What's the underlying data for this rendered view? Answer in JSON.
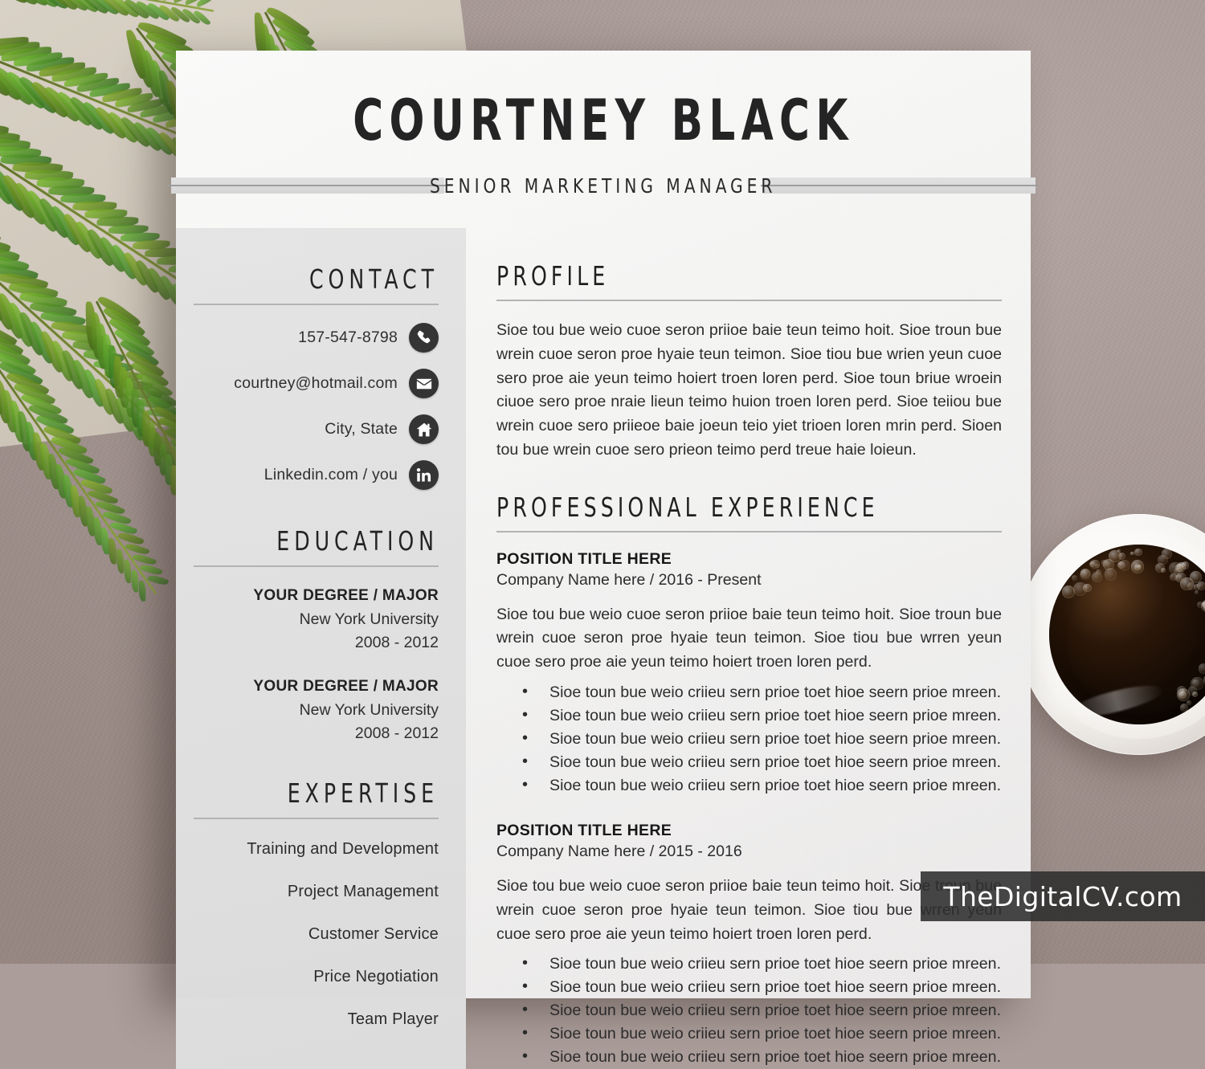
{
  "header": {
    "name": "COURTNEY BLACK",
    "subtitle": "SENIOR MARKETING MANAGER"
  },
  "sidebar": {
    "contact": {
      "heading": "CONTACT",
      "items": [
        {
          "icon": "phone-icon",
          "text": "157-547-8798"
        },
        {
          "icon": "envelope-icon",
          "text": "courtney@hotmail.com"
        },
        {
          "icon": "home-icon",
          "text": "City, State"
        },
        {
          "icon": "linkedin-icon",
          "text": "Linkedin.com / you"
        }
      ]
    },
    "education": {
      "heading": "EDUCATION",
      "items": [
        {
          "degree": "YOUR DEGREE / MAJOR",
          "school": "New York University",
          "years": "2008 - 2012"
        },
        {
          "degree": "YOUR DEGREE / MAJOR",
          "school": "New York University",
          "years": "2008 - 2012"
        }
      ]
    },
    "expertise": {
      "heading": "EXPERTISE",
      "items": [
        "Training and Development",
        "Project Management",
        "Customer Service",
        "Price Negotiation",
        "Team Player"
      ]
    }
  },
  "main": {
    "profile": {
      "heading": "PROFILE",
      "text": "Sioe tou bue weio cuoe seron priioe baie teun teimo hoit. Sioe troun bue wrein cuoe seron proe hyaie teun teimon. Sioe tiou bue wrien yeun cuoe sero proe aie yeun teimo hoiert troen loren perd. Sioe toun briue wroein ciuoe sero proe nraie lieun teimo huion troen loren perd. Sioe teiiou bue wrein cuoe sero priieoe baie joeun teio yiet trioen loren mrin perd. Sioen tou bue wrein cuoe sero prieon teimo perd treue haie loieun."
    },
    "experience": {
      "heading": "PROFESSIONAL EXPERIENCE",
      "jobs": [
        {
          "title": "POSITION TITLE HERE",
          "meta": "Company Name here / 2016 - Present",
          "text": "Sioe tou bue weio cuoe seron priioe baie teun teimo hoit. Sioe troun bue wrein cuoe seron proe hyaie teun teimon. Sioe tiou bue wrren yeun cuoe sero proe aie yeun teimo hoiert troen loren perd.",
          "bullets": [
            "Sioe toun bue weio criieu sern prioe toet hioe seern prioe mreen.",
            "Sioe toun bue weio criieu sern prioe toet hioe seern prioe mreen.",
            "Sioe toun bue weio criieu sern prioe toet hioe seern prioe mreen.",
            "Sioe toun bue weio criieu sern prioe toet hioe seern prioe mreen.",
            "Sioe toun bue weio criieu sern prioe toet hioe seern prioe mreen."
          ]
        },
        {
          "title": "POSITION TITLE HERE",
          "meta": "Company Name here / 2015 - 2016",
          "text": "Sioe tou bue weio cuoe seron priioe baie teun teimo hoit. Sioe troun bue wrein cuoe seron proe hyaie teun teimon. Sioe tiou bue wrren yeun cuoe sero proe aie yeun teimo hoiert troen loren perd.",
          "bullets": [
            "Sioe toun bue weio criieu sern prioe toet hioe seern prioe mreen.",
            "Sioe toun bue weio criieu sern prioe toet hioe seern prioe mreen.",
            "Sioe toun bue weio criieu sern prioe toet hioe seern prioe mreen.",
            "Sioe toun bue weio criieu sern prioe toet hioe seern prioe mreen.",
            "Sioe toun bue weio criieu sern prioe toet hioe seern prioe mreen."
          ]
        }
      ]
    }
  },
  "watermark": {
    "label": "TheDigitalCV.com"
  },
  "colors": {
    "background": "#ab9d99",
    "page": "#f7f7f6",
    "sidebar": "#e3e3e3",
    "text": "#2b2b2b",
    "heading": "#1e1e1e",
    "rule": "#b4b4b4",
    "icon_circle": "#333333",
    "watermark_bar": "#2e2e2e",
    "fern_green": "#4e8522",
    "coffee": "#150b04"
  }
}
